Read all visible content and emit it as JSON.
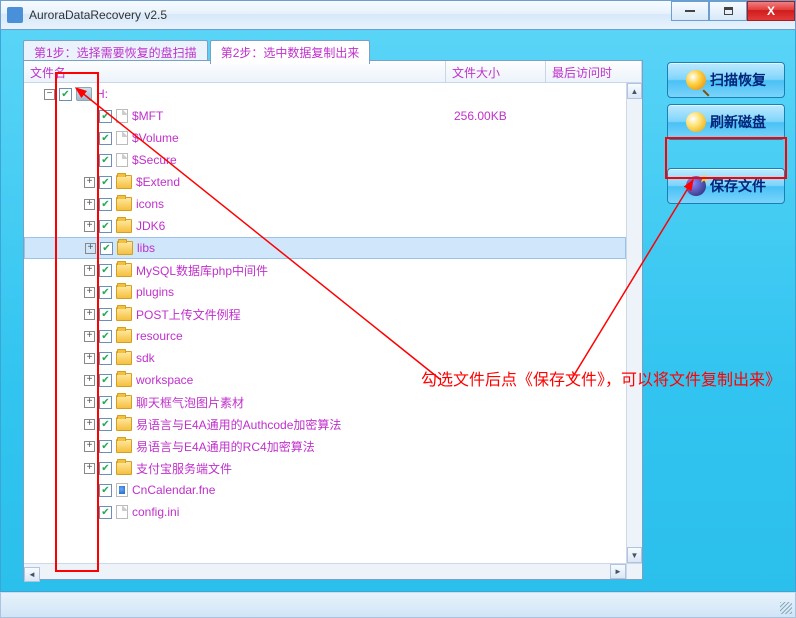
{
  "window": {
    "title": "AuroraDataRecovery v2.5"
  },
  "winbtns": {
    "close": "X"
  },
  "tabs": [
    {
      "label": "第1步：选择需要恢复的盘扫描",
      "active": false
    },
    {
      "label": "第2步：选中数据复制出来",
      "active": true
    }
  ],
  "columns": {
    "name": "文件名",
    "size": "文件大小",
    "time": "最后访问时"
  },
  "tree": {
    "root": {
      "name": "H:",
      "type": "drive"
    },
    "items": [
      {
        "name": "$MFT",
        "type": "file",
        "size": "256.00KB"
      },
      {
        "name": "$Volume",
        "type": "file"
      },
      {
        "name": "$Secure",
        "type": "file"
      },
      {
        "name": "$Extend",
        "type": "folder"
      },
      {
        "name": "icons",
        "type": "folder"
      },
      {
        "name": "JDK6",
        "type": "folder"
      },
      {
        "name": "libs",
        "type": "folder",
        "selected": true
      },
      {
        "name": "MySQL数据库php中间件",
        "type": "folder"
      },
      {
        "name": "plugins",
        "type": "folder"
      },
      {
        "name": "POST上传文件例程",
        "type": "folder"
      },
      {
        "name": "resource",
        "type": "folder"
      },
      {
        "name": "sdk",
        "type": "folder"
      },
      {
        "name": "workspace",
        "type": "folder"
      },
      {
        "name": "聊天框气泡图片素材",
        "type": "folder"
      },
      {
        "name": "易语言与E4A通用的Authcode加密算法",
        "type": "folder"
      },
      {
        "name": "易语言与E4A通用的RC4加密算法",
        "type": "folder"
      },
      {
        "name": "支付宝服务端文件",
        "type": "folder"
      },
      {
        "name": "CnCalendar.fne",
        "type": "fne"
      },
      {
        "name": "config.ini",
        "type": "file"
      }
    ]
  },
  "buttons": {
    "scan": "扫描恢复",
    "refresh": "刷新磁盘",
    "save": "保存文件"
  },
  "annotation": {
    "text": "勾选文件后点《保存文件》，可以将文件复制出来》"
  }
}
